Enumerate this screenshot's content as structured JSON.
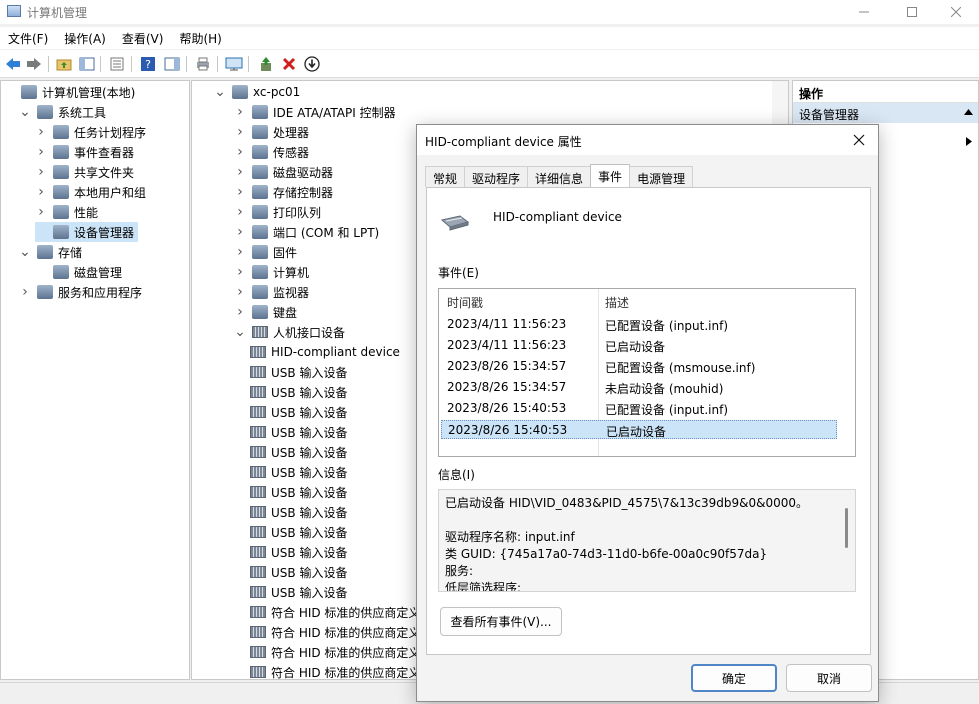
{
  "window": {
    "title": "计算机管理"
  },
  "menu": [
    "文件(F)",
    "操作(A)",
    "查看(V)",
    "帮助(H)"
  ],
  "left_tree": [
    {
      "label": "计算机管理(本地)",
      "indent": 0,
      "expander": "",
      "icon": "computer-management-icon"
    },
    {
      "label": "系统工具",
      "indent": 1,
      "expander": "v",
      "icon": "tools-icon"
    },
    {
      "label": "任务计划程序",
      "indent": 2,
      "expander": ">",
      "icon": "clock-icon"
    },
    {
      "label": "事件查看器",
      "indent": 2,
      "expander": ">",
      "icon": "event-viewer-icon"
    },
    {
      "label": "共享文件夹",
      "indent": 2,
      "expander": ">",
      "icon": "shared-folder-icon"
    },
    {
      "label": "本地用户和组",
      "indent": 2,
      "expander": ">",
      "icon": "users-icon"
    },
    {
      "label": "性能",
      "indent": 2,
      "expander": ">",
      "icon": "performance-icon"
    },
    {
      "label": "设备管理器",
      "indent": 2,
      "expander": "",
      "icon": "device-manager-icon",
      "selected": true
    },
    {
      "label": "存储",
      "indent": 1,
      "expander": "v",
      "icon": "storage-icon"
    },
    {
      "label": "磁盘管理",
      "indent": 2,
      "expander": "",
      "icon": "disk-icon"
    },
    {
      "label": "服务和应用程序",
      "indent": 1,
      "expander": ">",
      "icon": "services-icon"
    }
  ],
  "device_tree": [
    {
      "label": "xc-pc01",
      "level": 0,
      "expander": "v",
      "icon": "computer-icon"
    },
    {
      "label": "IDE ATA/ATAPI 控制器",
      "level": 1,
      "expander": ">",
      "icon": "ide-icon"
    },
    {
      "label": "处理器",
      "level": 1,
      "expander": ">",
      "icon": "cpu-icon"
    },
    {
      "label": "传感器",
      "level": 1,
      "expander": ">",
      "icon": "sensor-icon"
    },
    {
      "label": "磁盘驱动器",
      "level": 1,
      "expander": ">",
      "icon": "disk-drive-icon"
    },
    {
      "label": "存储控制器",
      "level": 1,
      "expander": ">",
      "icon": "storage-controller-icon"
    },
    {
      "label": "打印队列",
      "level": 1,
      "expander": ">",
      "icon": "printer-icon"
    },
    {
      "label": "端口 (COM 和 LPT)",
      "level": 1,
      "expander": ">",
      "icon": "port-icon"
    },
    {
      "label": "固件",
      "level": 1,
      "expander": ">",
      "icon": "firmware-icon"
    },
    {
      "label": "计算机",
      "level": 1,
      "expander": ">",
      "icon": "monitor-icon"
    },
    {
      "label": "监视器",
      "level": 1,
      "expander": ">",
      "icon": "display-icon"
    },
    {
      "label": "键盘",
      "level": 1,
      "expander": ">",
      "icon": "keyboard-icon"
    },
    {
      "label": "人机接口设备",
      "level": 1,
      "expander": "v",
      "icon": "hid-icon"
    },
    {
      "label": "HID-compliant device",
      "level": 2,
      "expander": "",
      "icon": "hid-icon"
    },
    {
      "label": "USB 输入设备",
      "level": 2,
      "expander": "",
      "icon": "hid-icon"
    },
    {
      "label": "USB 输入设备",
      "level": 2,
      "expander": "",
      "icon": "hid-icon"
    },
    {
      "label": "USB 输入设备",
      "level": 2,
      "expander": "",
      "icon": "hid-icon"
    },
    {
      "label": "USB 输入设备",
      "level": 2,
      "expander": "",
      "icon": "hid-icon"
    },
    {
      "label": "USB 输入设备",
      "level": 2,
      "expander": "",
      "icon": "hid-icon"
    },
    {
      "label": "USB 输入设备",
      "level": 2,
      "expander": "",
      "icon": "hid-icon"
    },
    {
      "label": "USB 输入设备",
      "level": 2,
      "expander": "",
      "icon": "hid-icon"
    },
    {
      "label": "USB 输入设备",
      "level": 2,
      "expander": "",
      "icon": "hid-icon"
    },
    {
      "label": "USB 输入设备",
      "level": 2,
      "expander": "",
      "icon": "hid-icon"
    },
    {
      "label": "USB 输入设备",
      "level": 2,
      "expander": "",
      "icon": "hid-icon"
    },
    {
      "label": "USB 输入设备",
      "level": 2,
      "expander": "",
      "icon": "hid-icon"
    },
    {
      "label": "USB 输入设备",
      "level": 2,
      "expander": "",
      "icon": "hid-icon"
    },
    {
      "label": "符合 HID 标准的供应商定义设备",
      "level": 2,
      "expander": "",
      "icon": "hid-icon"
    },
    {
      "label": "符合 HID 标准的供应商定义设备",
      "level": 2,
      "expander": "",
      "icon": "hid-icon"
    },
    {
      "label": "符合 HID 标准的供应商定义设备",
      "level": 2,
      "expander": "",
      "icon": "hid-icon"
    },
    {
      "label": "符合 HID 标准的供应商定义设备",
      "level": 2,
      "expander": "",
      "icon": "hid-icon"
    }
  ],
  "actions": {
    "header": "操作",
    "sub": "设备管理器"
  },
  "dialog": {
    "title": "HID-compliant device 属性",
    "tabs": [
      "常规",
      "驱动程序",
      "详细信息",
      "事件",
      "电源管理"
    ],
    "active_tab": "事件",
    "device_name": "HID-compliant device",
    "events_label": "事件(E)",
    "columns": [
      "时间戳",
      "描述"
    ],
    "events": [
      {
        "ts": "2023/4/11 11:56:23",
        "desc": "已配置设备 (input.inf)"
      },
      {
        "ts": "2023/4/11 11:56:23",
        "desc": "已启动设备"
      },
      {
        "ts": "2023/8/26 15:34:57",
        "desc": "已配置设备 (msmouse.inf)"
      },
      {
        "ts": "2023/8/26 15:34:57",
        "desc": "未启动设备 (mouhid)"
      },
      {
        "ts": "2023/8/26 15:40:53",
        "desc": "已配置设备 (input.inf)"
      },
      {
        "ts": "2023/8/26 15:40:53",
        "desc": "已启动设备",
        "selected": true
      }
    ],
    "info_label": "信息(I)",
    "info_lines": [
      "已启动设备 HID\\VID_0483&PID_4575\\7&13c39db9&0&0000。",
      "",
      "驱动程序名称: input.inf",
      "类 GUID: {745a17a0-74d3-11d0-b6fe-00a0c90f57da}",
      "服务:",
      "低层筛选程序:"
    ],
    "view_all_button": "查看所有事件(V)...",
    "ok_button": "确定",
    "cancel_button": "取消"
  }
}
